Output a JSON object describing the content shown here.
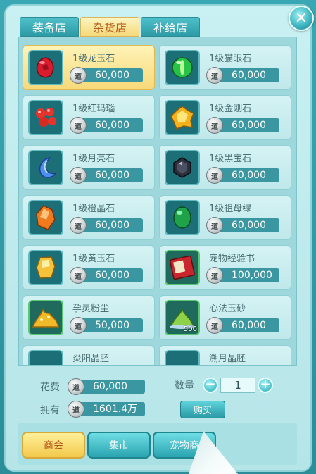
{
  "tabs": [
    "装备店",
    "杂货店",
    "补给店"
  ],
  "active_tab": 1,
  "close_label": "✕",
  "coin_glyph": "道",
  "items": [
    {
      "name": "1级龙玉石",
      "price": "60,000",
      "icon": "red-jade-gem-icon",
      "selected": true
    },
    {
      "name": "1级猫眼石",
      "price": "60,000",
      "icon": "green-cats-eye-gem-icon",
      "selected": false
    },
    {
      "name": "1级红玛瑙",
      "price": "60,000",
      "icon": "red-agate-beads-icon",
      "selected": false
    },
    {
      "name": "1级金刚石",
      "price": "60,000",
      "icon": "gold-diamond-icon",
      "selected": false
    },
    {
      "name": "1级月亮石",
      "price": "60,000",
      "icon": "crescent-moonstone-icon",
      "selected": false
    },
    {
      "name": "1级黑宝石",
      "price": "60,000",
      "icon": "black-gem-icon",
      "selected": false
    },
    {
      "name": "1级橙晶石",
      "price": "60,000",
      "icon": "orange-crystal-icon",
      "selected": false
    },
    {
      "name": "1级祖母绿",
      "price": "60,000",
      "icon": "emerald-icon",
      "selected": false
    },
    {
      "name": "1级黄玉石",
      "price": "60,000",
      "icon": "yellow-topaz-icon",
      "selected": false
    },
    {
      "name": "宠物经验书",
      "price": "100,000",
      "icon": "pet-exp-book-icon",
      "selected": false
    },
    {
      "name": "孕灵粉尘",
      "price": "50,000",
      "icon": "spirit-dust-pile-icon",
      "selected": false
    },
    {
      "name": "心法玉砂",
      "price": "60,000",
      "icon": "jade-sand-pile-icon",
      "selected": false,
      "badge": "500"
    },
    {
      "name": "炎阳晶胚",
      "price": "",
      "icon": "sun-crystal-embryo-icon",
      "selected": false
    },
    {
      "name": "溯月晶胚",
      "price": "",
      "icon": "moon-crystal-embryo-icon",
      "selected": false
    }
  ],
  "footer": {
    "cost_label": "花费",
    "cost_value": "60,000",
    "owned_label": "拥有",
    "owned_value": "1601.4万",
    "qty_label": "数量",
    "qty_value": "1",
    "minus_label": "−",
    "plus_label": "+",
    "buy_label": "购买"
  },
  "bottom_tabs": [
    "商会",
    "集市",
    "宠物商"
  ],
  "bottom_active": 0,
  "colors": {
    "accent_teal": "#3a97a2",
    "selected_gold": "#f7d978",
    "panel_bg": "#c9f0f2"
  }
}
